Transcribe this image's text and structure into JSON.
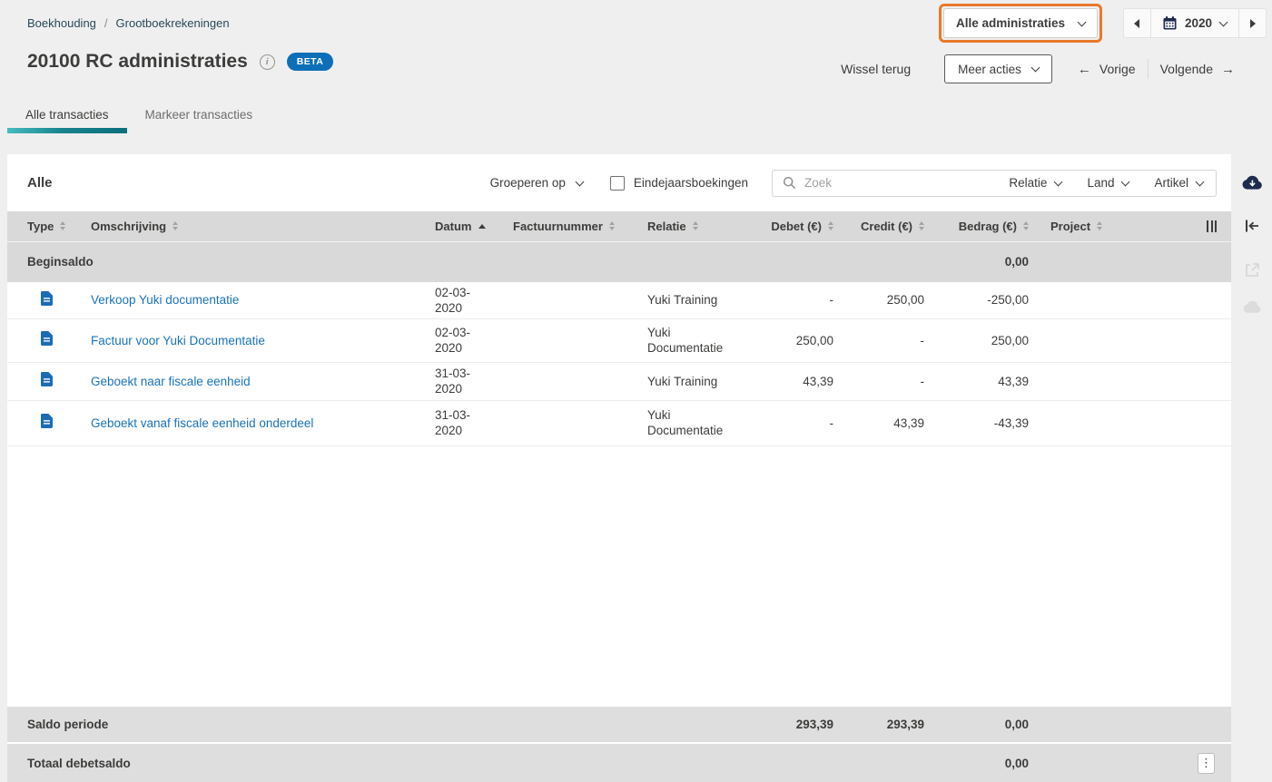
{
  "breadcrumb": {
    "items": [
      {
        "label": "Boekhouding"
      },
      {
        "label": "Grootboekrekeningen"
      }
    ],
    "separator": "/"
  },
  "topbar": {
    "administration_dropdown": "Alle administraties",
    "year": "2020"
  },
  "header": {
    "title": "20100 RC administraties",
    "beta_badge": "BETA",
    "wissel_terug_label": "Wissel terug",
    "meer_acties_label": "Meer acties",
    "vorige_label": "Vorige",
    "volgende_label": "Volgende",
    "vorige_arrow": "←",
    "volgende_arrow": "→"
  },
  "tabs": [
    {
      "label": "Alle transacties",
      "active": true
    },
    {
      "label": "Markeer transacties",
      "active": false
    }
  ],
  "toolbar": {
    "group_label": "Alle",
    "groeperen_op_label": "Groeperen op",
    "eindejaarsboekingen_label": "Eindejaarsboekingen",
    "eindejaarsboekingen_checked": false,
    "search_placeholder": "Zoek",
    "filters": [
      {
        "label": "Relatie"
      },
      {
        "label": "Land"
      },
      {
        "label": "Artikel"
      }
    ]
  },
  "table": {
    "columns": [
      "Type",
      "Omschrijving",
      "Datum",
      "Factuurnummer",
      "Relatie",
      "Debet (€)",
      "Credit (€)",
      "Bedrag (€)",
      "Project"
    ],
    "sorted_column": "Datum",
    "sort_direction": "asc",
    "beginsaldo": {
      "label": "Beginsaldo",
      "bedrag": "0,00"
    },
    "rows": [
      {
        "omschrijving": "Verkoop Yuki documentatie",
        "datum": "02-03-2020",
        "factuurnummer": "",
        "relatie": "Yuki Training",
        "debet": "-",
        "credit": "250,00",
        "bedrag": "-250,00",
        "project": ""
      },
      {
        "omschrijving": "Factuur voor Yuki Documentatie",
        "datum": "02-03-2020",
        "factuurnummer": "",
        "relatie": "Yuki Documentatie",
        "debet": "250,00",
        "credit": "-",
        "bedrag": "250,00",
        "project": ""
      },
      {
        "omschrijving": "Geboekt naar fiscale eenheid",
        "datum": "31-03-2020",
        "factuurnummer": "",
        "relatie": "Yuki Training",
        "debet": "43,39",
        "credit": "-",
        "bedrag": "43,39",
        "project": ""
      },
      {
        "omschrijving": "Geboekt vanaf fiscale eenheid onderdeel",
        "datum": "31-03-2020",
        "factuurnummer": "",
        "relatie": "Yuki Documentatie",
        "debet": "-",
        "credit": "43,39",
        "bedrag": "-43,39",
        "project": ""
      }
    ],
    "footer": {
      "saldo_periode": {
        "label": "Saldo periode",
        "debet": "293,39",
        "credit": "293,39",
        "bedrag": "0,00"
      },
      "totaal_debetsaldo": {
        "label": "Totaal debetsaldo",
        "bedrag": "0,00"
      }
    }
  },
  "icons": {
    "kebab": "⋮"
  },
  "colors": {
    "accent_teal": "#0d7c87",
    "link_blue": "#1a72b8",
    "beta_blue": "#0d6fb8",
    "highlight_orange": "#e8792b",
    "icon_navy": "#1d2b4d",
    "header_gray": "#d9d9d9",
    "footer_gray": "#dfdede"
  }
}
